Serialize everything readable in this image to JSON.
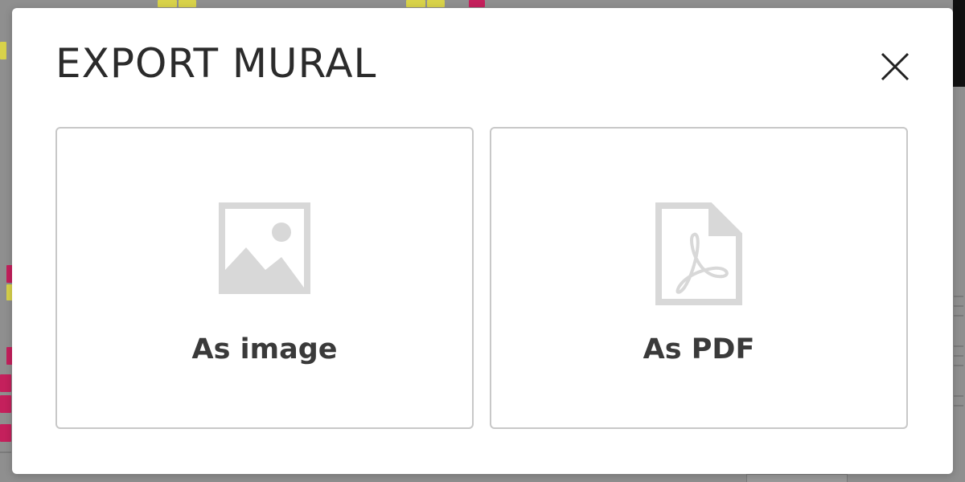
{
  "modal": {
    "title": "EXPORT MURAL",
    "close_icon": "close-icon"
  },
  "options": [
    {
      "label": "As image",
      "icon": "image-icon"
    },
    {
      "label": "As PDF",
      "icon": "pdf-file-icon"
    }
  ],
  "colors": {
    "backdrop": "#8f8f8f",
    "modal_background": "#ffffff",
    "card_border": "#c8c8c8",
    "icon_gray": "#d8d8d8",
    "label_text": "#3a3a3a",
    "sticky_yellow": "#d8d24a",
    "sticky_pink": "#c4205c"
  }
}
